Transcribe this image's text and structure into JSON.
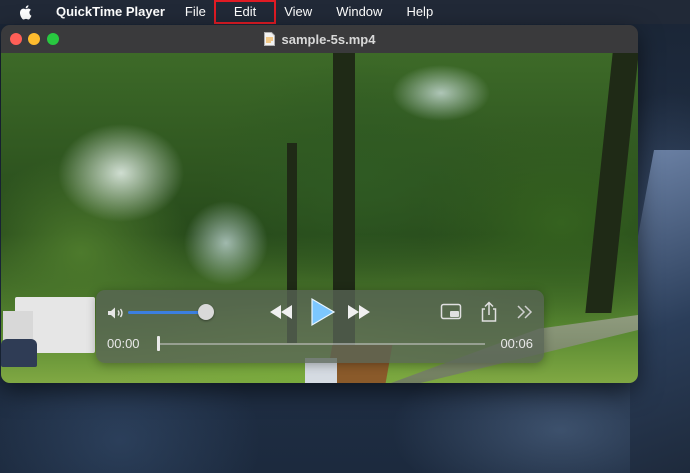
{
  "menubar": {
    "app_name": "QuickTime Player",
    "items": [
      "File",
      "Edit",
      "View",
      "Window",
      "Help"
    ]
  },
  "window": {
    "title": "sample-5s.mp4"
  },
  "controls": {
    "volume_level": 0.9,
    "time_current": "00:00",
    "time_total": "00:06",
    "progress": 0.0
  },
  "colors": {
    "highlight": "#e01b24",
    "volume_accent": "#3b7fe0",
    "play_icon": "#6fc3ff"
  }
}
